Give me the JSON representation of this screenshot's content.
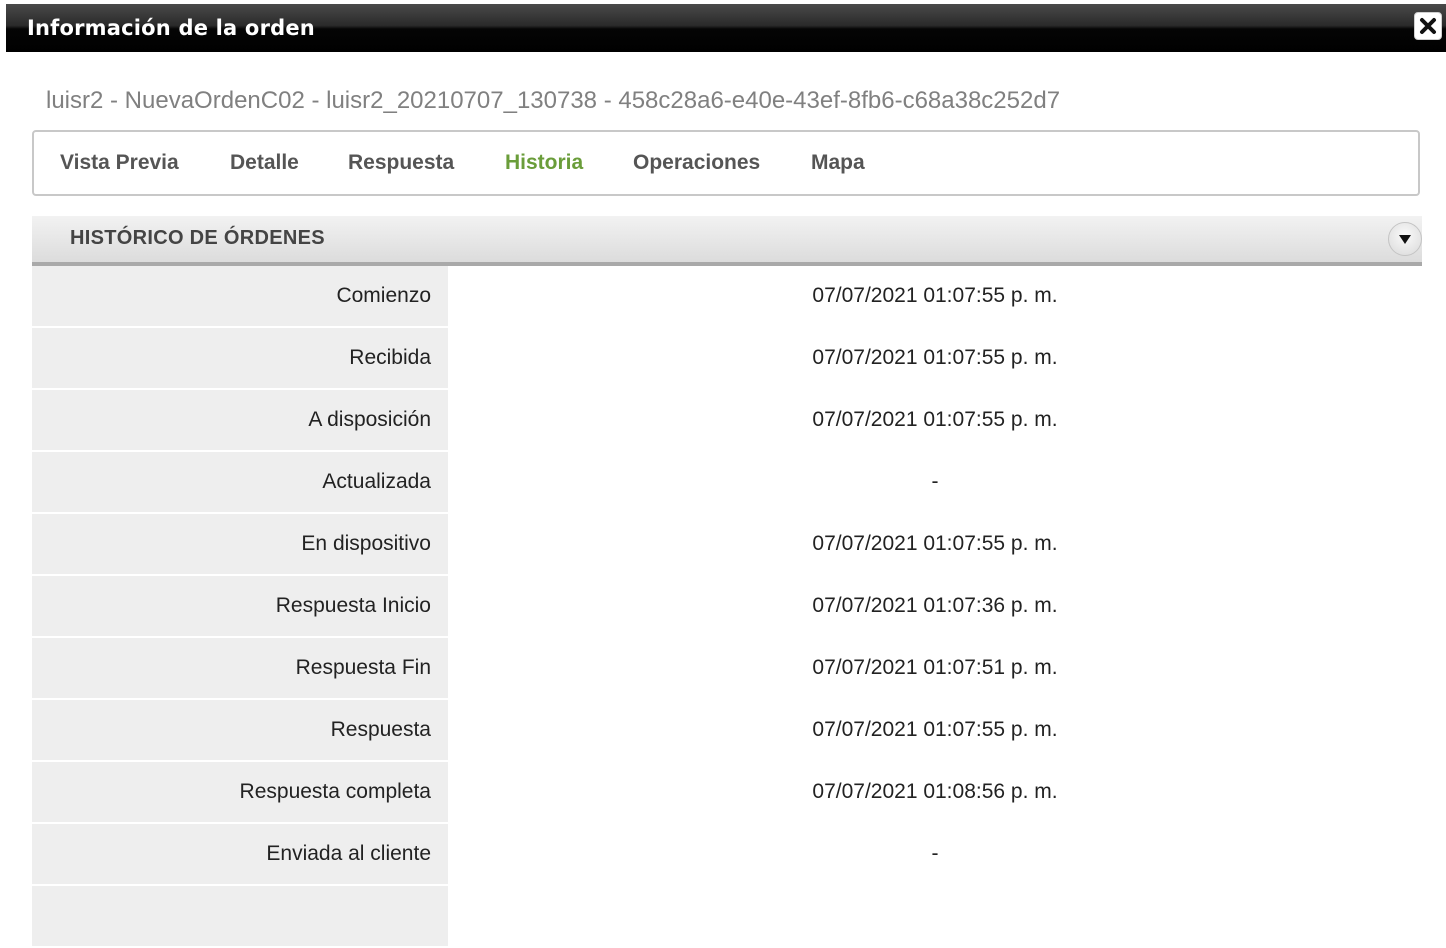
{
  "dialog": {
    "title": "Información de la orden",
    "close_icon": "close-icon"
  },
  "order": {
    "subtitle": "luisr2 - NuevaOrdenC02 - luisr2_20210707_130738 - 458c28a6-e40e-43ef-8fb6-c68a38c252d7"
  },
  "tabs": [
    {
      "label": "Vista Previa",
      "active": false
    },
    {
      "label": "Detalle",
      "active": false
    },
    {
      "label": "Respuesta",
      "active": false
    },
    {
      "label": "Historia",
      "active": true
    },
    {
      "label": "Operaciones",
      "active": false
    },
    {
      "label": "Mapa",
      "active": false
    }
  ],
  "colors": {
    "active_tab": "#6a9d3a",
    "titlebar": "#000000"
  },
  "history": {
    "title": "HISTÓRICO DE ÓRDENES",
    "toggle_icon": "chevron-down-icon",
    "rows": [
      {
        "label": "Comienzo",
        "value": "07/07/2021 01:07:55 p. m."
      },
      {
        "label": "Recibida",
        "value": "07/07/2021 01:07:55 p. m."
      },
      {
        "label": "A disposición",
        "value": "07/07/2021 01:07:55 p. m."
      },
      {
        "label": "Actualizada",
        "value": "-"
      },
      {
        "label": "En dispositivo",
        "value": "07/07/2021 01:07:55 p. m."
      },
      {
        "label": "Respuesta Inicio",
        "value": "07/07/2021 01:07:36 p. m."
      },
      {
        "label": "Respuesta Fin",
        "value": "07/07/2021 01:07:51 p. m."
      },
      {
        "label": "Respuesta",
        "value": "07/07/2021 01:07:55 p. m."
      },
      {
        "label": "Respuesta completa",
        "value": "07/07/2021 01:08:56 p. m."
      },
      {
        "label": "Enviada al cliente",
        "value": "-"
      },
      {
        "label": "",
        "value": ""
      }
    ]
  }
}
